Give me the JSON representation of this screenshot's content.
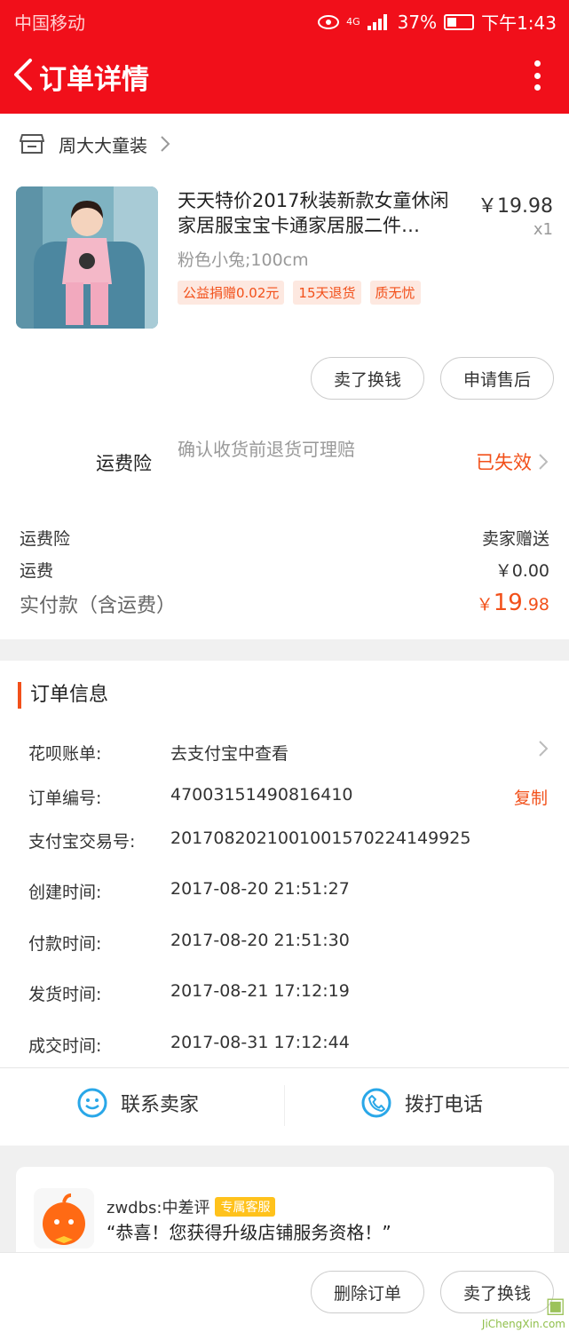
{
  "status_bar": {
    "carrier": "中国移动",
    "network": "4G",
    "battery": "37%",
    "time": "下午1:43"
  },
  "nav": {
    "title": "订单详情"
  },
  "shop": {
    "name": "周大大童装"
  },
  "product": {
    "title": "天天特价2017秋装新款女童休闲家居服宝宝卡通家居服二件…",
    "price": "￥19.98",
    "quantity": "x1",
    "sku": "粉色小兔;100cm",
    "tags": [
      "公益捐赠0.02元",
      "15天退货",
      "质无忧"
    ]
  },
  "item_actions": {
    "sell_label": "卖了换钱",
    "after_sale_label": "申请售后"
  },
  "insurance": {
    "label": "运费险",
    "desc": "确认收货前退货可理赔",
    "status": "已失效"
  },
  "summary": {
    "rows": [
      {
        "label": "运费险",
        "value": "卖家赠送"
      },
      {
        "label": "运费",
        "value": "￥0.00"
      }
    ],
    "total_label": "实付款（含运费）",
    "total_yen": "￥",
    "total_int": "19",
    "total_dec": ".98"
  },
  "order_info": {
    "title": "订单信息",
    "rows": [
      {
        "label": "花呗账单:",
        "value": "去支付宝中查看"
      },
      {
        "label": "订单编号:",
        "value": "47003151490816410",
        "action": "复制"
      },
      {
        "label": "支付宝交易号:",
        "value": "2017082021001001570224149925"
      },
      {
        "label": "创建时间:",
        "value": "2017-08-20 21:51:27"
      },
      {
        "label": "付款时间:",
        "value": "2017-08-20 21:51:30"
      },
      {
        "label": "发货时间:",
        "value": "2017-08-21 17:12:19"
      },
      {
        "label": "成交时间:",
        "value": "2017-08-31 17:12:44"
      }
    ]
  },
  "contact": {
    "seller_label": "联系卖家",
    "call_label": "拨打电话"
  },
  "message": {
    "sender": "zwdbs:中差评",
    "badge": "专属客服",
    "text": "“恭喜！您获得升级店铺服务资格！”"
  },
  "bottom_actions": {
    "delete_label": "删除订单",
    "sell_label": "卖了换钱"
  },
  "watermark": {
    "brand": "JiChengXin.com"
  },
  "colors": {
    "brand_red": "#f10f1a",
    "accent_orange": "#f2501a",
    "contact_blue": "#29a7e8"
  }
}
